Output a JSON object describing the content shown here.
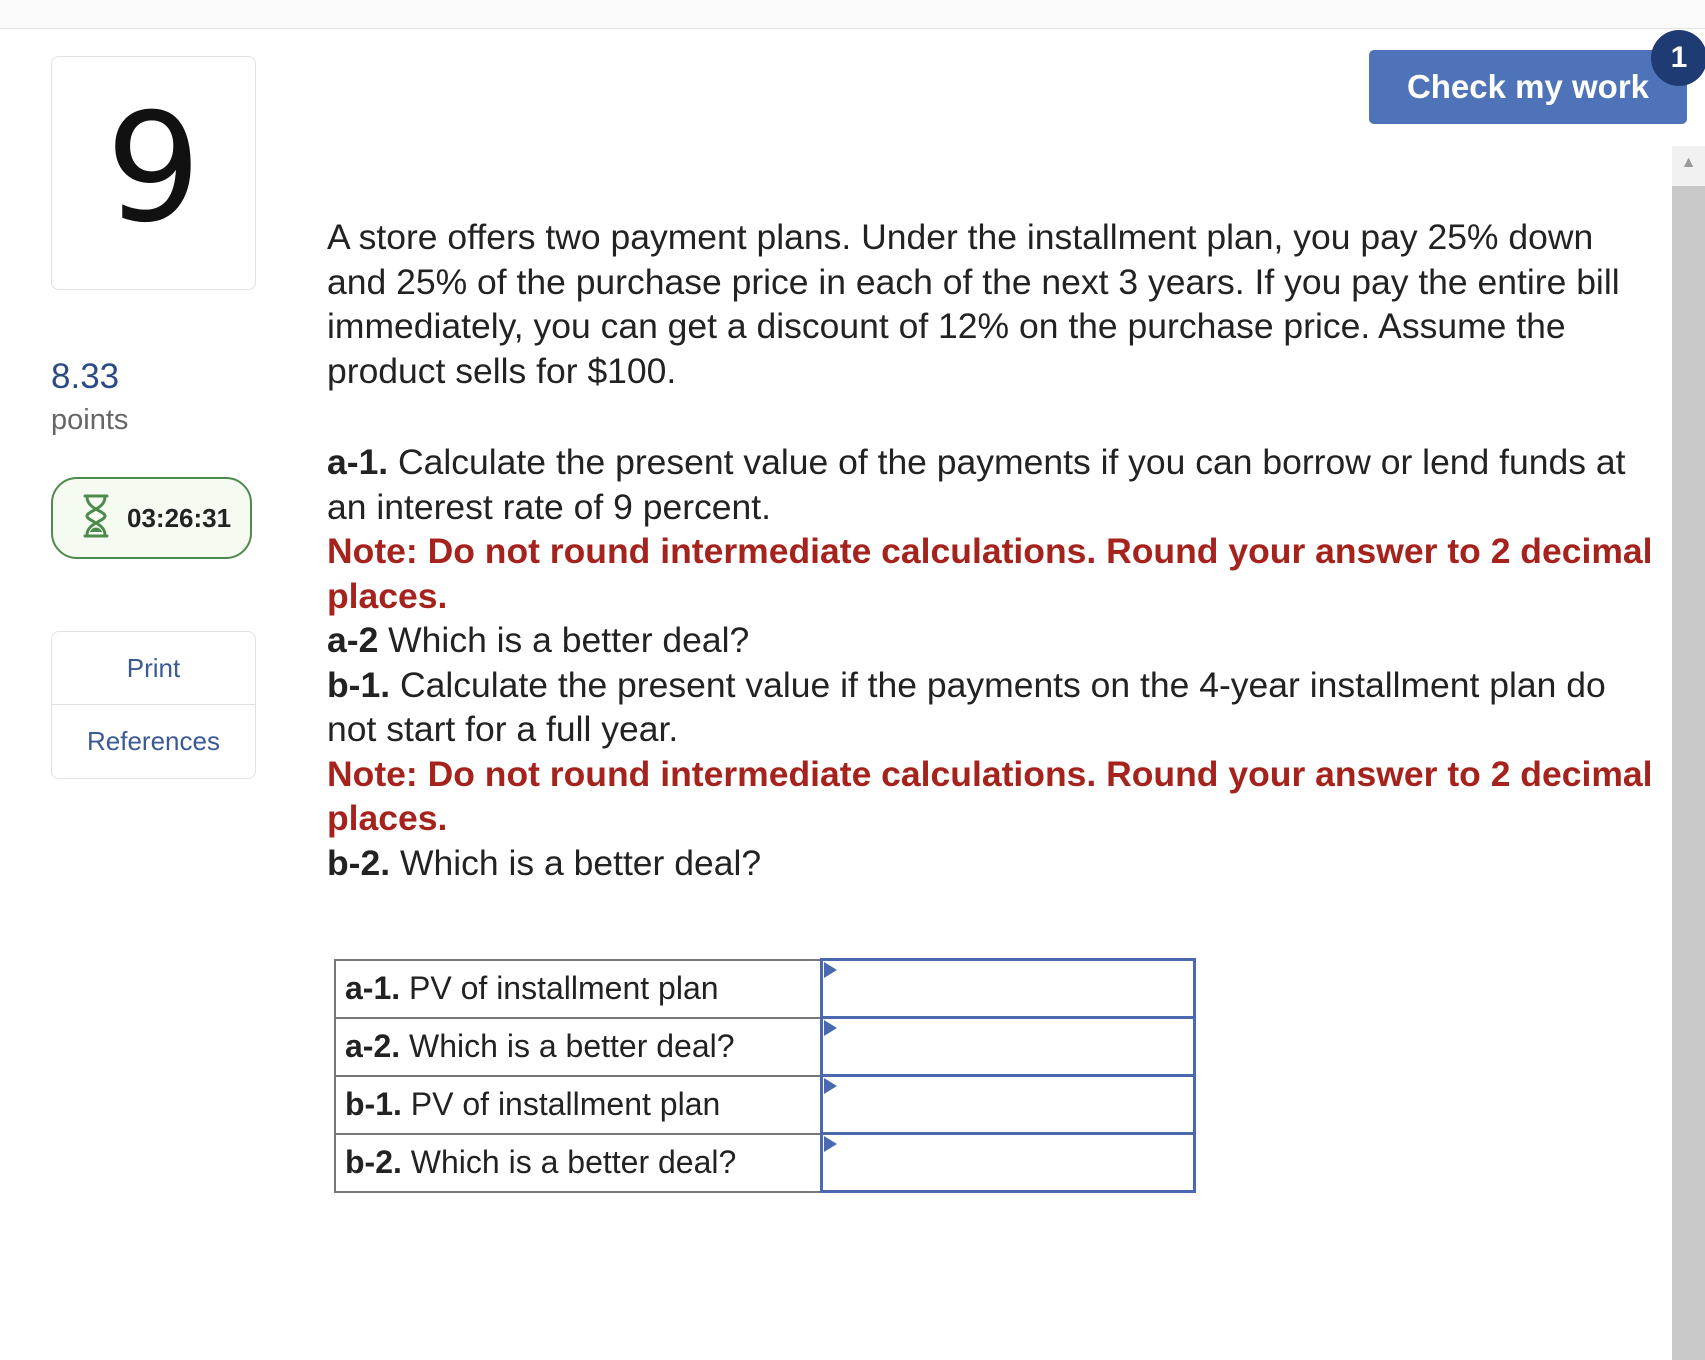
{
  "question": {
    "number": "9",
    "points_value": "8.33",
    "points_label": "points",
    "timer": "03:26:31"
  },
  "sidebar": {
    "print_label": "Print",
    "references_label": "References"
  },
  "header": {
    "check_label": "Check my work",
    "badge_count": "1"
  },
  "body": {
    "intro": "A store offers two payment plans. Under the installment plan, you pay 25% down and 25% of the purchase price in each of the next 3 years. If you pay the entire bill immediately, you can get a discount of 12% on the purchase price. Assume the product sells for $100.",
    "a1_prefix": "a-1.",
    "a1_text": " Calculate the present value of the payments if you can borrow or lend funds at an interest rate of 9 percent.",
    "note1": "Note: Do not round intermediate calculations. Round your answer to 2 decimal places.",
    "a2_prefix": "a-2",
    "a2_text": " Which is a better deal?",
    "b1_prefix": "b-1.",
    "b1_text": " Calculate the present value if the payments on the 4-year installment plan do not start for a full year.",
    "note2": "Note: Do not round intermediate calculations. Round your answer to 2 decimal places.",
    "b2_prefix": "b-2.",
    "b2_text": " Which is a better deal?"
  },
  "answers": {
    "rows": [
      {
        "prefix": "a-1.",
        "label": " PV of installment plan",
        "value": ""
      },
      {
        "prefix": "a-2.",
        "label": " Which is a better deal?",
        "value": ""
      },
      {
        "prefix": "b-1.",
        "label": " PV of installment plan",
        "value": ""
      },
      {
        "prefix": "b-2.",
        "label": " Which is a better deal?",
        "value": ""
      }
    ]
  },
  "colors": {
    "accent": "#4f73b8",
    "note_red": "#a6231d",
    "badge": "#1f3b73",
    "timer_border": "#4e8a4e"
  }
}
